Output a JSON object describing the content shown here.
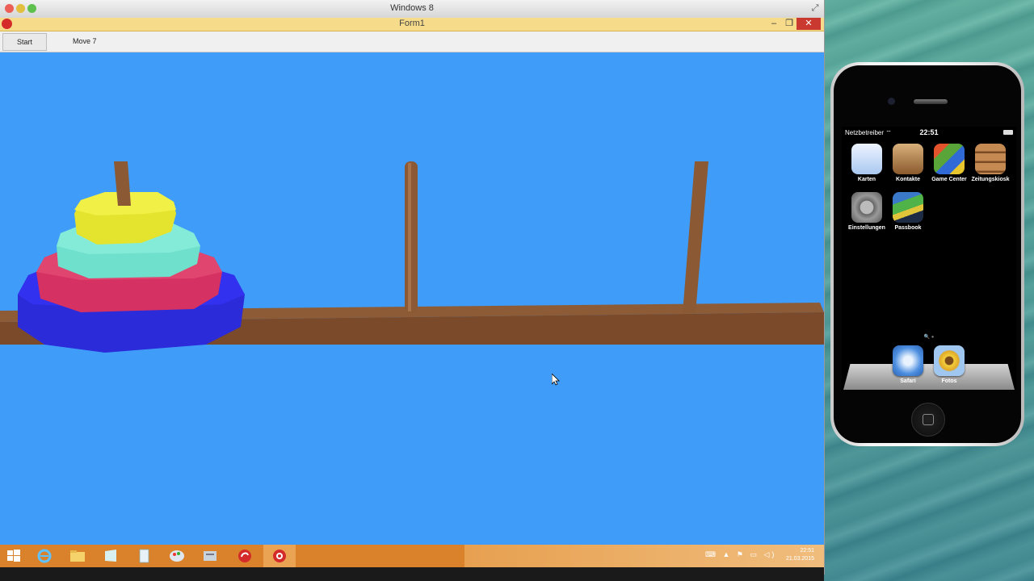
{
  "host": {
    "title": "Windows 8"
  },
  "form": {
    "title": "Form1",
    "start_label": "Start",
    "move_label": "Move 7",
    "close_glyph": "✕",
    "minimize_glyph": "–",
    "restore_glyph": "❐"
  },
  "scene": {
    "background_color": "#3f9df9",
    "base_color": "#7a4a2a",
    "peg_color": "#8b5a34",
    "disk_colors": [
      "#2b2bd9",
      "#d63163",
      "#6fe0cc",
      "#e4e42e"
    ],
    "pegs": [
      "peg-left",
      "peg-middle",
      "peg-right"
    ],
    "disks_on_left_peg": 4
  },
  "taskbar": {
    "time": "22:51",
    "date": "21.03.2015",
    "tray": "⌨ ▲ ⚑ ▭ ◁)"
  },
  "iphone": {
    "carrier": "Netzbetreiber",
    "time": "22:51",
    "apps": [
      {
        "label": "Karten",
        "icon": "maps-icon",
        "color": "#cfe3ff"
      },
      {
        "label": "Kontakte",
        "icon": "contacts-icon",
        "color": "#b78a56"
      },
      {
        "label": "Game Center",
        "icon": "game-center-icon",
        "color": "#6aa33c"
      },
      {
        "label": "Zeitungskiosk",
        "icon": "newsstand-icon",
        "color": "#b57a45"
      },
      {
        "label": "Einstellungen",
        "icon": "settings-icon",
        "color": "#8d8d8d"
      },
      {
        "label": "Passbook",
        "icon": "passbook-icon",
        "color": "#2d4b7a"
      }
    ],
    "dock": [
      {
        "label": "Safari",
        "icon": "safari-icon",
        "color": "#4d8fe0"
      },
      {
        "label": "Fotos",
        "icon": "photos-icon",
        "color": "#e3c23a"
      }
    ],
    "page_dots": "🔍 ●"
  }
}
